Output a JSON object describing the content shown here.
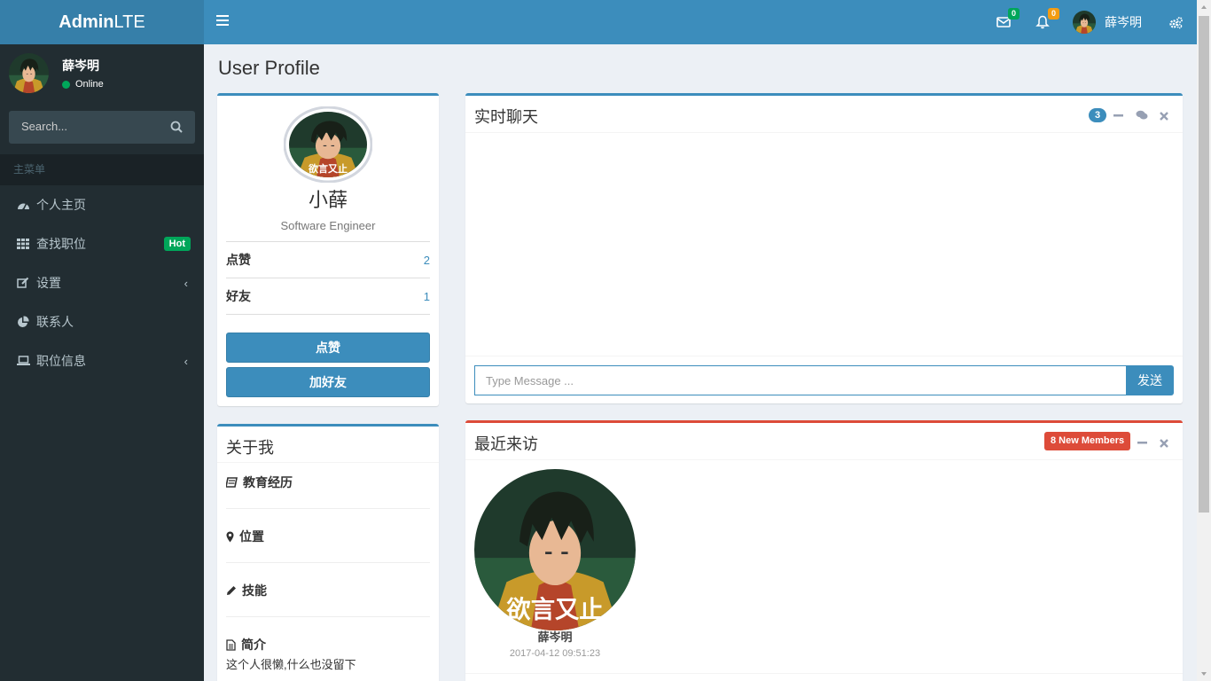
{
  "header": {
    "logo_bold": "Admin",
    "logo_rest": "LTE",
    "mail_count": "0",
    "notif_count": "0",
    "user_name": "薛岑明"
  },
  "sidebar": {
    "user_name": "薛岑明",
    "status": "Online",
    "search_placeholder": "Search...",
    "menu_header": "主菜单",
    "items": [
      {
        "label": "个人主页",
        "icon": "dashboard-icon"
      },
      {
        "label": "查找职位",
        "icon": "grid-icon",
        "badge": "Hot"
      },
      {
        "label": "设置",
        "icon": "edit-icon"
      },
      {
        "label": "联系人",
        "icon": "pie-chart-icon"
      },
      {
        "label": "职位信息",
        "icon": "laptop-icon"
      }
    ]
  },
  "page": {
    "title": "User Profile"
  },
  "profile": {
    "name": "小薛",
    "role": "Software Engineer",
    "likes_label": "点赞",
    "likes_value": "2",
    "friends_label": "好友",
    "friends_value": "1",
    "like_button": "点赞",
    "add_friend_button": "加好友",
    "avatar_caption": "欲言又止"
  },
  "about": {
    "title": "关于我",
    "education": "教育经历",
    "location": "位置",
    "skills": "技能",
    "bio_label": "简介",
    "bio_text": "这个人很懒,什么也没留下"
  },
  "chat": {
    "title": "实时聊天",
    "count": "3",
    "placeholder": "Type Message ...",
    "send": "发送"
  },
  "visitors": {
    "title": "最近来访",
    "badge": "8 New Members",
    "items": [
      {
        "name": "薛岑明",
        "date": "2017-04-12 09:51:23",
        "caption": "欲言又止"
      }
    ]
  },
  "colors": {
    "primary": "#3c8dbc",
    "danger": "#dd4b39",
    "success": "#00a65a",
    "warning": "#f39c12",
    "sidebar_bg": "#222d32"
  }
}
